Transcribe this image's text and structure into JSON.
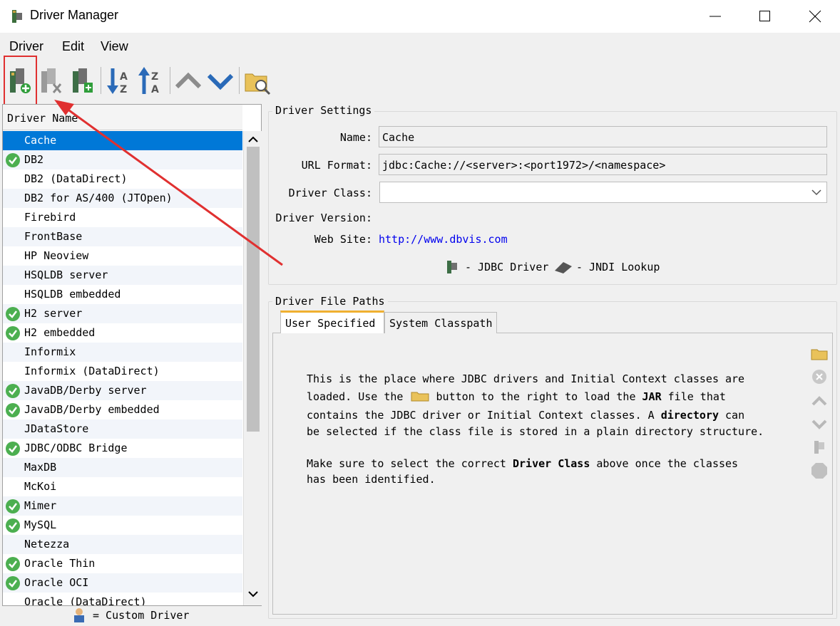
{
  "window": {
    "title": "Driver Manager"
  },
  "menu": [
    "Driver",
    "Edit",
    "View"
  ],
  "toolbar_icons": [
    "create-driver-icon",
    "remove-driver-icon",
    "copy-driver-icon",
    "sort-ascending-icon",
    "sort-descending-icon",
    "move-up-icon",
    "move-down-icon",
    "find-drivers-icon"
  ],
  "driver_list": {
    "header": "Driver Name",
    "rows": [
      {
        "name": "Cache",
        "checked": false,
        "selected": true
      },
      {
        "name": "DB2",
        "checked": true
      },
      {
        "name": "DB2 (DataDirect)",
        "checked": false
      },
      {
        "name": "DB2 for AS/400 (JTOpen)",
        "checked": false
      },
      {
        "name": "Firebird",
        "checked": false
      },
      {
        "name": "FrontBase",
        "checked": false
      },
      {
        "name": "HP Neoview",
        "checked": false
      },
      {
        "name": "HSQLDB server",
        "checked": false
      },
      {
        "name": "HSQLDB embedded",
        "checked": false
      },
      {
        "name": "H2 server",
        "checked": true
      },
      {
        "name": "H2 embedded",
        "checked": true
      },
      {
        "name": "Informix",
        "checked": false
      },
      {
        "name": "Informix (DataDirect)",
        "checked": false
      },
      {
        "name": "JavaDB/Derby server",
        "checked": true
      },
      {
        "name": "JavaDB/Derby embedded",
        "checked": true
      },
      {
        "name": "JDataStore",
        "checked": false
      },
      {
        "name": "JDBC/ODBC Bridge",
        "checked": true
      },
      {
        "name": "MaxDB",
        "checked": false
      },
      {
        "name": "McKoi",
        "checked": false
      },
      {
        "name": "Mimer",
        "checked": true
      },
      {
        "name": "MySQL",
        "checked": true
      },
      {
        "name": "Netezza",
        "checked": false
      },
      {
        "name": "Oracle Thin",
        "checked": true
      },
      {
        "name": "Oracle OCI",
        "checked": true
      },
      {
        "name": "Oracle (DataDirect)",
        "checked": false
      }
    ],
    "legend": "= Custom Driver"
  },
  "settings": {
    "title": "Driver Settings",
    "name_label": "Name:",
    "name_value": "Cache",
    "url_label": "URL Format:",
    "url_value": "jdbc:Cache://<server>:<port1972>/<namespace>",
    "class_label": "Driver Class:",
    "class_value": "",
    "version_label": "Driver Version:",
    "website_label": "Web Site:",
    "website_value": "http://www.dbvis.com",
    "legend_jdbc": "- JDBC Driver",
    "legend_jndi": "- JNDI Lookup"
  },
  "paths": {
    "title": "Driver File Paths",
    "tabs": [
      "User Specified",
      "System Classpath"
    ],
    "p1_line1": "This is the place where JDBC drivers and Initial Context classes are",
    "p1_line2a": "loaded. Use the",
    "p1_line2b": "button to the right to load the",
    "p1_line2_bold": "JAR",
    "p1_line2c": "file that",
    "p1_line3a": "contains the JDBC driver or Initial Context classes. A",
    "p1_line3_bold": "directory",
    "p1_line3b": "can",
    "p1_line4": "be selected if the class file is stored in a plain directory structure.",
    "p2_line1a": "Make sure to select the correct",
    "p2_line1_bold": "Driver Class",
    "p2_line1b": "above once the classes",
    "p2_line2": "has been identified."
  },
  "colors": {
    "selection": "#0078d7",
    "check": "#4caf50",
    "link": "#0000ee",
    "annotation": "#e03030"
  }
}
